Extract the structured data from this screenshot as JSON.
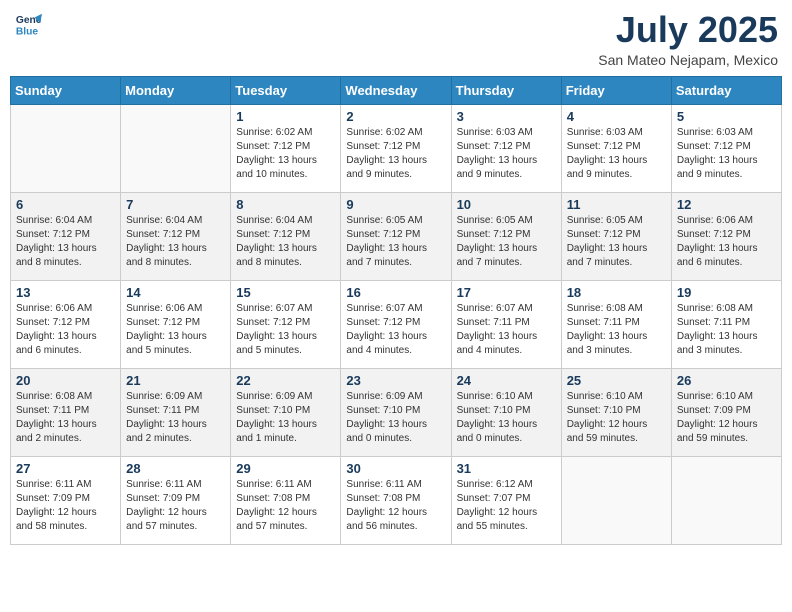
{
  "header": {
    "logo_line1": "General",
    "logo_line2": "Blue",
    "month_year": "July 2025",
    "location": "San Mateo Nejapam, Mexico"
  },
  "weekdays": [
    "Sunday",
    "Monday",
    "Tuesday",
    "Wednesday",
    "Thursday",
    "Friday",
    "Saturday"
  ],
  "weeks": [
    {
      "shaded": false,
      "days": [
        {
          "date": "",
          "info": ""
        },
        {
          "date": "",
          "info": ""
        },
        {
          "date": "1",
          "info": "Sunrise: 6:02 AM\nSunset: 7:12 PM\nDaylight: 13 hours and 10 minutes."
        },
        {
          "date": "2",
          "info": "Sunrise: 6:02 AM\nSunset: 7:12 PM\nDaylight: 13 hours and 9 minutes."
        },
        {
          "date": "3",
          "info": "Sunrise: 6:03 AM\nSunset: 7:12 PM\nDaylight: 13 hours and 9 minutes."
        },
        {
          "date": "4",
          "info": "Sunrise: 6:03 AM\nSunset: 7:12 PM\nDaylight: 13 hours and 9 minutes."
        },
        {
          "date": "5",
          "info": "Sunrise: 6:03 AM\nSunset: 7:12 PM\nDaylight: 13 hours and 9 minutes."
        }
      ]
    },
    {
      "shaded": true,
      "days": [
        {
          "date": "6",
          "info": "Sunrise: 6:04 AM\nSunset: 7:12 PM\nDaylight: 13 hours and 8 minutes."
        },
        {
          "date": "7",
          "info": "Sunrise: 6:04 AM\nSunset: 7:12 PM\nDaylight: 13 hours and 8 minutes."
        },
        {
          "date": "8",
          "info": "Sunrise: 6:04 AM\nSunset: 7:12 PM\nDaylight: 13 hours and 8 minutes."
        },
        {
          "date": "9",
          "info": "Sunrise: 6:05 AM\nSunset: 7:12 PM\nDaylight: 13 hours and 7 minutes."
        },
        {
          "date": "10",
          "info": "Sunrise: 6:05 AM\nSunset: 7:12 PM\nDaylight: 13 hours and 7 minutes."
        },
        {
          "date": "11",
          "info": "Sunrise: 6:05 AM\nSunset: 7:12 PM\nDaylight: 13 hours and 7 minutes."
        },
        {
          "date": "12",
          "info": "Sunrise: 6:06 AM\nSunset: 7:12 PM\nDaylight: 13 hours and 6 minutes."
        }
      ]
    },
    {
      "shaded": false,
      "days": [
        {
          "date": "13",
          "info": "Sunrise: 6:06 AM\nSunset: 7:12 PM\nDaylight: 13 hours and 6 minutes."
        },
        {
          "date": "14",
          "info": "Sunrise: 6:06 AM\nSunset: 7:12 PM\nDaylight: 13 hours and 5 minutes."
        },
        {
          "date": "15",
          "info": "Sunrise: 6:07 AM\nSunset: 7:12 PM\nDaylight: 13 hours and 5 minutes."
        },
        {
          "date": "16",
          "info": "Sunrise: 6:07 AM\nSunset: 7:12 PM\nDaylight: 13 hours and 4 minutes."
        },
        {
          "date": "17",
          "info": "Sunrise: 6:07 AM\nSunset: 7:11 PM\nDaylight: 13 hours and 4 minutes."
        },
        {
          "date": "18",
          "info": "Sunrise: 6:08 AM\nSunset: 7:11 PM\nDaylight: 13 hours and 3 minutes."
        },
        {
          "date": "19",
          "info": "Sunrise: 6:08 AM\nSunset: 7:11 PM\nDaylight: 13 hours and 3 minutes."
        }
      ]
    },
    {
      "shaded": true,
      "days": [
        {
          "date": "20",
          "info": "Sunrise: 6:08 AM\nSunset: 7:11 PM\nDaylight: 13 hours and 2 minutes."
        },
        {
          "date": "21",
          "info": "Sunrise: 6:09 AM\nSunset: 7:11 PM\nDaylight: 13 hours and 2 minutes."
        },
        {
          "date": "22",
          "info": "Sunrise: 6:09 AM\nSunset: 7:10 PM\nDaylight: 13 hours and 1 minute."
        },
        {
          "date": "23",
          "info": "Sunrise: 6:09 AM\nSunset: 7:10 PM\nDaylight: 13 hours and 0 minutes."
        },
        {
          "date": "24",
          "info": "Sunrise: 6:10 AM\nSunset: 7:10 PM\nDaylight: 13 hours and 0 minutes."
        },
        {
          "date": "25",
          "info": "Sunrise: 6:10 AM\nSunset: 7:10 PM\nDaylight: 12 hours and 59 minutes."
        },
        {
          "date": "26",
          "info": "Sunrise: 6:10 AM\nSunset: 7:09 PM\nDaylight: 12 hours and 59 minutes."
        }
      ]
    },
    {
      "shaded": false,
      "days": [
        {
          "date": "27",
          "info": "Sunrise: 6:11 AM\nSunset: 7:09 PM\nDaylight: 12 hours and 58 minutes."
        },
        {
          "date": "28",
          "info": "Sunrise: 6:11 AM\nSunset: 7:09 PM\nDaylight: 12 hours and 57 minutes."
        },
        {
          "date": "29",
          "info": "Sunrise: 6:11 AM\nSunset: 7:08 PM\nDaylight: 12 hours and 57 minutes."
        },
        {
          "date": "30",
          "info": "Sunrise: 6:11 AM\nSunset: 7:08 PM\nDaylight: 12 hours and 56 minutes."
        },
        {
          "date": "31",
          "info": "Sunrise: 6:12 AM\nSunset: 7:07 PM\nDaylight: 12 hours and 55 minutes."
        },
        {
          "date": "",
          "info": ""
        },
        {
          "date": "",
          "info": ""
        }
      ]
    }
  ]
}
